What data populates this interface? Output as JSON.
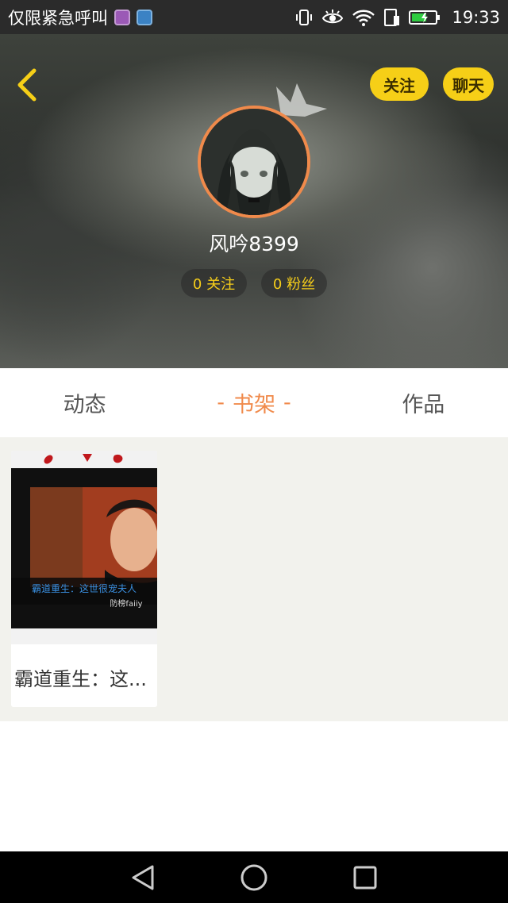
{
  "status_bar": {
    "carrier_text": "仅限紧急呼叫",
    "time": "19:33",
    "icons": [
      "gallery-notification-icon",
      "cloud-notification-icon",
      "vibrate-icon",
      "eye-icon",
      "wifi-icon",
      "sim-icon",
      "battery-charging-icon"
    ]
  },
  "header": {
    "follow_label": "关注",
    "chat_label": "聊天",
    "username": "风吟8399",
    "following_text": "0 关注",
    "fans_text": "0 粉丝",
    "accent_color": "#f6cf17",
    "avatar_ring_color": "#f08a4b"
  },
  "tabs": [
    {
      "label": "动态",
      "active": false
    },
    {
      "label": "书架",
      "active": true
    },
    {
      "label": "作品",
      "active": false
    }
  ],
  "active_tab_dash": "-",
  "shelf": {
    "books": [
      {
        "title": "霸道重生：这...",
        "cover_text_main": "霸道重生：这世很宠夫人",
        "cover_text_author": "防榜faiiy"
      }
    ]
  },
  "nav_bar": {
    "buttons": [
      "back-icon",
      "home-icon",
      "recents-icon"
    ]
  }
}
